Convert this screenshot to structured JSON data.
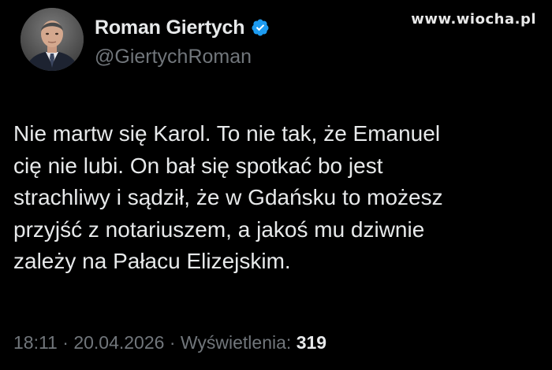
{
  "watermark": "www.wiocha.pl",
  "author": {
    "display_name": "Roman Giertych",
    "handle": "@GiertychRoman",
    "verified": true,
    "verified_icon": "verified-badge-icon",
    "avatar_icon": "profile-photo"
  },
  "tweet": {
    "lines": [
      "Nie martw się Karol. To nie tak, że Emanuel",
      "cię nie lubi. On bał się spotkać bo jest",
      "strachliwy i sądził, że w Gdańsku to możesz",
      "przyjść z notariuszem, a jakoś mu dziwnie",
      "zależy na Pałacu Elizejskim."
    ]
  },
  "meta": {
    "time": "18:11",
    "sep1": " · ",
    "date": "20.04.2026",
    "sep2": " · ",
    "views_label": "Wyświetlenia: ",
    "views_count": "319"
  },
  "colors": {
    "background": "#000000",
    "text_primary": "#e7e9ea",
    "text_secondary": "#71767b",
    "verified_blue": "#1d9bf0"
  }
}
